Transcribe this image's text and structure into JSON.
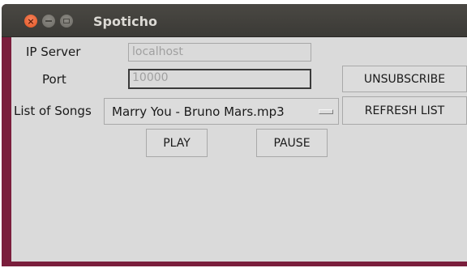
{
  "window": {
    "title": "Spoticho"
  },
  "form": {
    "ip_label": "IP Server",
    "ip_value": "localhost",
    "port_label": "Port",
    "port_value": "10000",
    "songs_label": "List of Songs",
    "selected_song": "Marry You - Bruno Mars.mp3"
  },
  "buttons": {
    "unsubscribe": "UNSUBSCRIBE",
    "refresh": "REFRESH LIST",
    "play": "PLAY",
    "pause": "PAUSE"
  },
  "icons": {
    "close": "close-icon",
    "minimize": "minimize-icon",
    "maximize": "maximize-icon"
  }
}
